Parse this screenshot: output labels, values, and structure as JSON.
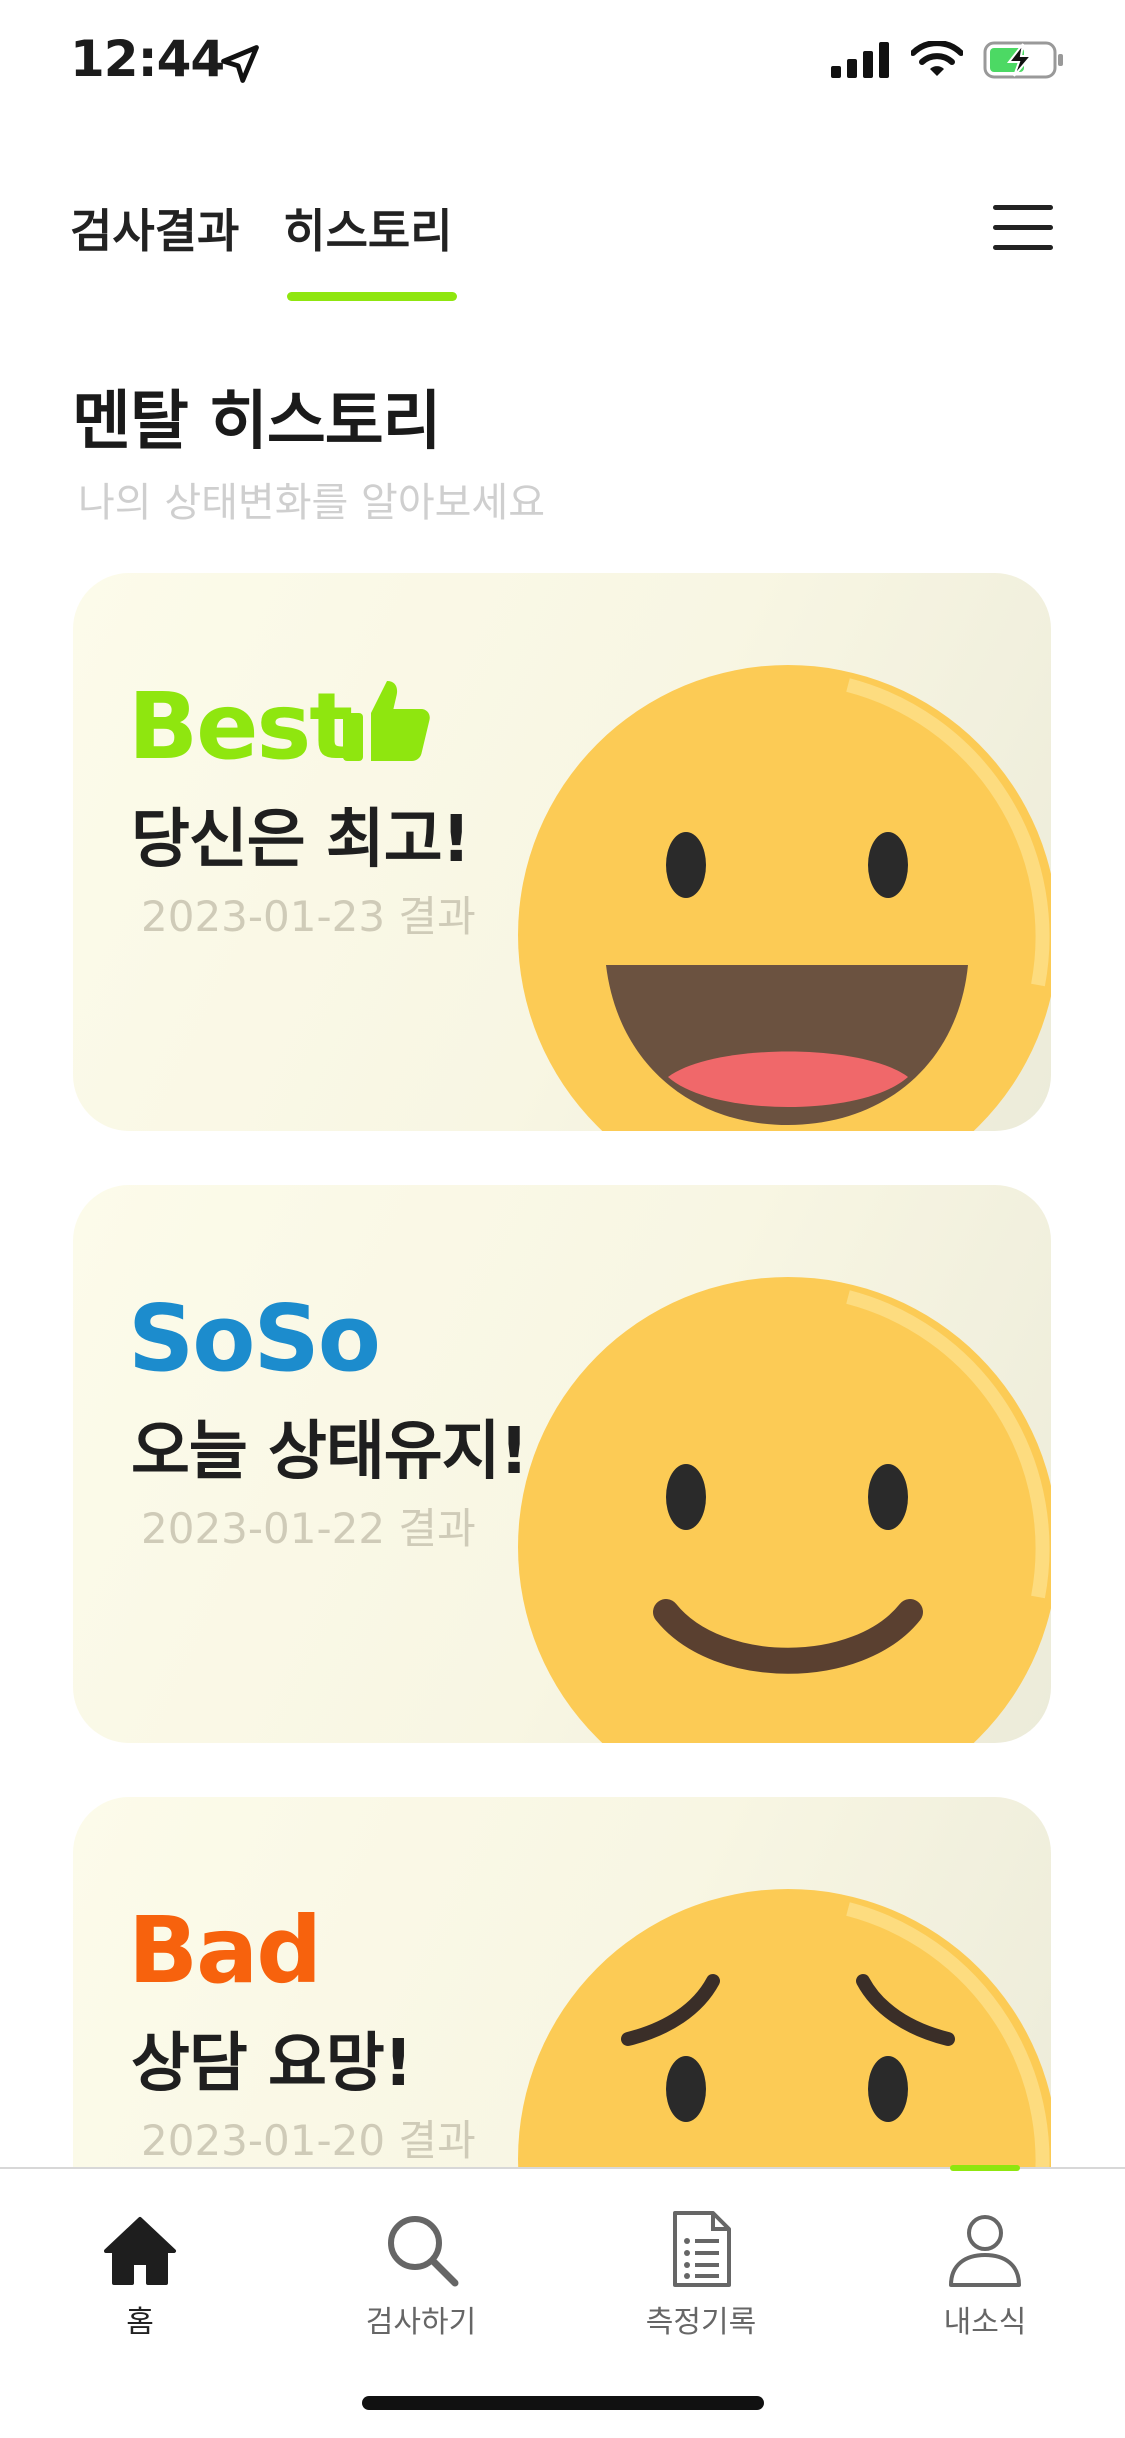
{
  "status_bar": {
    "time": "12:44"
  },
  "top_tabs": [
    {
      "label": "검사결과",
      "active": false
    },
    {
      "label": "히스토리",
      "active": true
    }
  ],
  "page": {
    "title": "멘탈 히스토리",
    "subtitle": "나의 상태변화를 알아보세요"
  },
  "cards": [
    {
      "level": "Best",
      "level_color": "#8fe60f",
      "message": "당신은 최고!",
      "date": "2023-01-23 결과",
      "face": "laughing"
    },
    {
      "level": "SoSo",
      "level_color": "#1c8ccd",
      "message": "오늘 상태유지!",
      "date": "2023-01-22 결과",
      "face": "smiling"
    },
    {
      "level": "Bad",
      "level_color": "#f7620d",
      "message": "상담 요망!",
      "date": "2023-01-20 결과",
      "face": "worried"
    }
  ],
  "bottom_nav": [
    {
      "label": "홈",
      "icon": "home-icon",
      "active": true
    },
    {
      "label": "검사하기",
      "icon": "search-icon",
      "active": false
    },
    {
      "label": "측정기록",
      "icon": "document-icon",
      "active": false
    },
    {
      "label": "내소식",
      "icon": "person-icon",
      "active": false
    }
  ],
  "colors": {
    "accent": "#8fe60f",
    "face": "#fccb55"
  }
}
